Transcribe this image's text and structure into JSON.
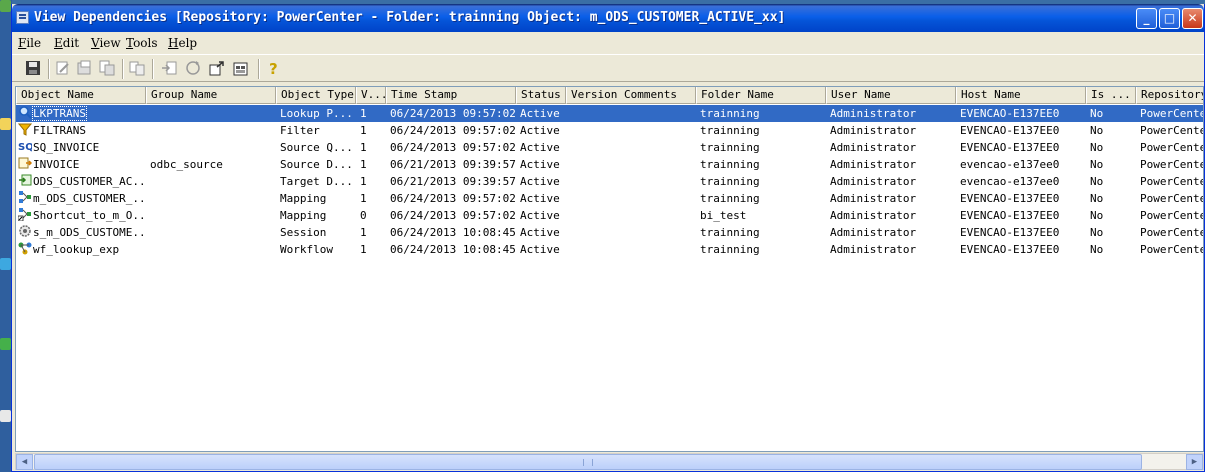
{
  "window": {
    "title": "View Dependencies [Repository: PowerCenter - Folder: trainning Object: m_ODS_CUSTOMER_ACTIVE_xx]"
  },
  "menu": [
    {
      "label": "File",
      "key": "F",
      "rest": "ile"
    },
    {
      "label": "Edit",
      "key": "E",
      "rest": "dit"
    },
    {
      "label": "View",
      "key": "V",
      "rest": "iew"
    },
    {
      "label": "Tools",
      "key": "T",
      "rest": "ools"
    },
    {
      "label": "Help",
      "key": "H",
      "rest": "elp"
    }
  ],
  "toolbar": {
    "icons": [
      "save-icon",
      "edit-properties-icon",
      "export-icon",
      "copy-icon",
      "compare-icon",
      "import-icon",
      "refresh-icon",
      "open-icon",
      "properties-icon",
      "help-icon"
    ]
  },
  "table": {
    "columns": [
      "Object Name",
      "Group Name",
      "Object Type",
      "V...",
      "Time Stamp",
      "Status",
      "Version Comments",
      "Folder Name",
      "User Name",
      "Host Name",
      "Is ...",
      "Repository"
    ],
    "rows": [
      {
        "icon": "lookup-icon",
        "cells": [
          "LKPTRANS",
          "",
          "Lookup P...",
          "1",
          "06/24/2013 09:57:02",
          "Active",
          "",
          "trainning",
          "Administrator",
          "EVENCAO-E137EE0",
          "No",
          "PowerCenter"
        ]
      },
      {
        "icon": "filter-icon",
        "cells": [
          "FILTRANS",
          "",
          "Filter",
          "1",
          "06/24/2013 09:57:02",
          "Active",
          "",
          "trainning",
          "Administrator",
          "EVENCAO-E137EE0",
          "No",
          "PowerCenter"
        ]
      },
      {
        "icon": "source-qualifier-icon",
        "cells": [
          "SQ_INVOICE",
          "",
          "Source Q...",
          "1",
          "06/24/2013 09:57:02",
          "Active",
          "",
          "trainning",
          "Administrator",
          "EVENCAO-E137EE0",
          "No",
          "PowerCenter"
        ]
      },
      {
        "icon": "source-definition-icon",
        "cells": [
          "INVOICE",
          "odbc_source",
          "Source D...",
          "1",
          "06/21/2013 09:39:57",
          "Active",
          "",
          "trainning",
          "Administrator",
          "evencao-e137ee0",
          "No",
          "PowerCenter"
        ]
      },
      {
        "icon": "target-definition-icon",
        "cells": [
          "ODS_CUSTOMER_AC...",
          "",
          "Target D...",
          "1",
          "06/21/2013 09:39:57",
          "Active",
          "",
          "trainning",
          "Administrator",
          "evencao-e137ee0",
          "No",
          "PowerCenter"
        ]
      },
      {
        "icon": "mapping-icon",
        "cells": [
          "m_ODS_CUSTOMER_...",
          "",
          "Mapping",
          "1",
          "06/24/2013 09:57:02",
          "Active",
          "",
          "trainning",
          "Administrator",
          "EVENCAO-E137EE0",
          "No",
          "PowerCenter"
        ]
      },
      {
        "icon": "shortcut-mapping-icon",
        "cells": [
          "Shortcut_to_m_O...",
          "",
          "Mapping",
          "0",
          "06/24/2013 09:57:02",
          "Active",
          "",
          "bi_test",
          "Administrator",
          "EVENCAO-E137EE0",
          "No",
          "PowerCenter"
        ]
      },
      {
        "icon": "session-icon",
        "cells": [
          "s_m_ODS_CUSTOME...",
          "",
          "Session",
          "1",
          "06/24/2013 10:08:45",
          "Active",
          "",
          "trainning",
          "Administrator",
          "EVENCAO-E137EE0",
          "No",
          "PowerCenter"
        ]
      },
      {
        "icon": "workflow-icon",
        "cells": [
          "wf_lookup_exp",
          "",
          "Workflow",
          "1",
          "06/24/2013 10:08:45",
          "Active",
          "",
          "trainning",
          "Administrator",
          "EVENCAO-E137EE0",
          "No",
          "PowerCenter"
        ]
      }
    ]
  },
  "colors": {
    "selection": "#316ac5",
    "title_bar": "#0a5fe9"
  }
}
